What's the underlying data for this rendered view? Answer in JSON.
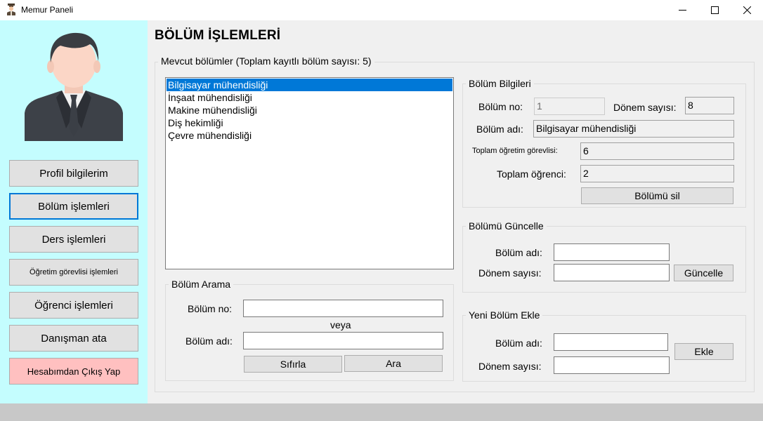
{
  "window": {
    "title": "Memur Paneli",
    "icon": "officer-icon",
    "controls": [
      "minimize-icon",
      "maximize-icon",
      "close-icon"
    ]
  },
  "sidebar": {
    "background": "#c4fdfe",
    "avatar": "user-avatar-icon",
    "items": [
      {
        "label": "Profil bilgilerim"
      },
      {
        "label": "Bölüm işlemleri",
        "active": true
      },
      {
        "label": "Ders işlemleri"
      },
      {
        "label": "Öğretim görevlisi işlemleri"
      },
      {
        "label": "Öğrenci işlemleri"
      },
      {
        "label": "Danışman ata"
      },
      {
        "label": "Hesabımdan Çıkış Yap",
        "color": "#ffc0c0"
      }
    ]
  },
  "main": {
    "title": "BÖLÜM İŞLEMLERİ",
    "existing": {
      "label": "Mevcut bölümler (Toplam kayıtlı bölüm sayısı: 5)",
      "items": [
        "Bilgisayar mühendisliği",
        "İnşaat mühendisliği",
        "Makine mühendisliği",
        "Diş hekimliği",
        "Çevre mühendisliği"
      ],
      "selected_index": 0
    },
    "info": {
      "label": "Bölüm Bilgileri",
      "no_label": "Bölüm no:",
      "no_value": "1",
      "term_label": "Dönem sayısı:",
      "term_value": "8",
      "name_label": "Bölüm adı:",
      "name_value": "Bilgisayar mühendisliği",
      "instructors_label": "Toplam öğretim görevlisi:",
      "instructors_value": "6",
      "students_label": "Toplam öğrenci:",
      "students_value": "2",
      "delete_label": "Bölümü sil"
    },
    "update": {
      "label": "Bölümü Güncelle",
      "name_label": "Bölüm adı:",
      "name_value": "",
      "term_label": "Dönem sayısı:",
      "term_value": "",
      "button_label": "Güncelle"
    },
    "search": {
      "label": "Bölüm Arama",
      "no_label": "Bölüm no:",
      "no_value": "",
      "or_label": "veya",
      "name_label": "Bölüm adı:",
      "name_value": "",
      "reset_label": "Sıfırla",
      "search_label": "Ara"
    },
    "add": {
      "label": "Yeni Bölüm Ekle",
      "name_label": "Bölüm adı:",
      "name_value": "",
      "term_label": "Dönem sayısı:",
      "term_value": "",
      "button_label": "Ekle"
    }
  }
}
